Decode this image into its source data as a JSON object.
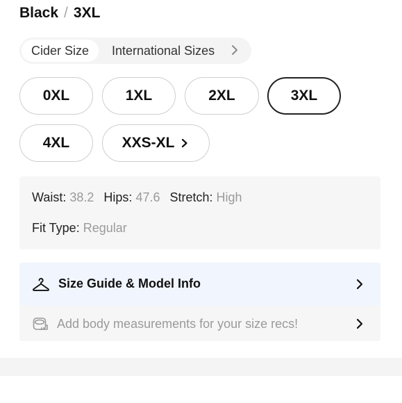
{
  "selection": {
    "color": "Black",
    "separator": "/",
    "size": "3XL"
  },
  "size_system_tabs": [
    {
      "label": "Cider Size",
      "active": true
    },
    {
      "label": "International Sizes",
      "active": false
    }
  ],
  "sizes": [
    {
      "label": "0XL",
      "selected": false
    },
    {
      "label": "1XL",
      "selected": false
    },
    {
      "label": "2XL",
      "selected": false
    },
    {
      "label": "3XL",
      "selected": true
    },
    {
      "label": "4XL",
      "selected": false
    },
    {
      "label": "XXS-XL",
      "selected": false,
      "icon": "chevron-right-icon"
    }
  ],
  "measurements": {
    "waist_label": "Waist:",
    "waist_value": "38.2",
    "hips_label": "Hips:",
    "hips_value": "47.6",
    "stretch_label": "Stretch:",
    "stretch_value": "High",
    "fit_label": "Fit Type:",
    "fit_value": "Regular"
  },
  "size_guide": {
    "label": "Size Guide & Model Info",
    "icon": "hanger-icon"
  },
  "body_measurements": {
    "label": "Add body measurements for your size recs!",
    "icon": "measuring-tape-icon"
  },
  "colors": {
    "selected_border": "#222222",
    "pill_border": "#cfcfcf",
    "panel_bg": "#f6f6f6",
    "guide_highlight_bg": "#f1f5fd",
    "muted_text": "#9a9a9a"
  }
}
